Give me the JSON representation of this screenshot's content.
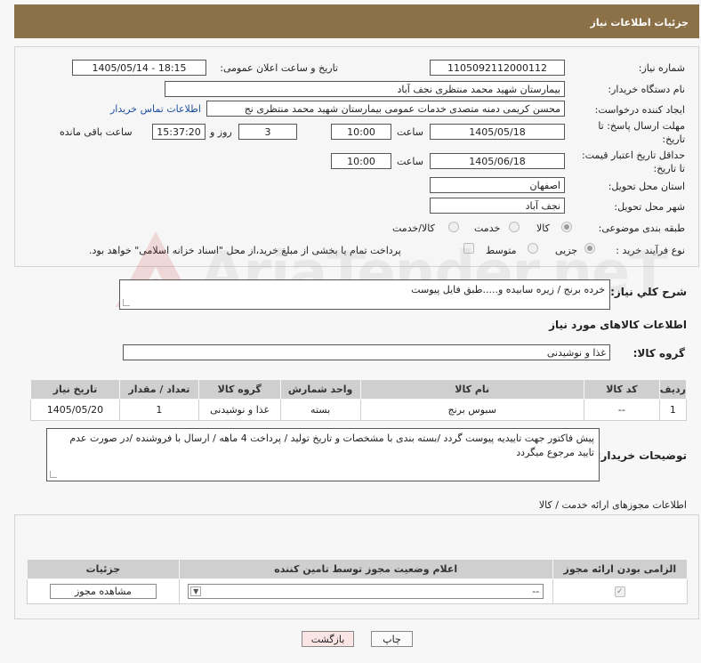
{
  "page_title": "جزئیات اطلاعات نیاز",
  "fields": {
    "need_number_label": "شماره نیاز:",
    "need_number": "1105092112000112",
    "announce_label": "تاریخ و ساعت اعلان عمومی:",
    "announce_value": "1405/05/14 - 18:15",
    "buyer_org_label": "نام دستگاه خریدار:",
    "buyer_org": "بیمارستان شهید محمد منتظری نجف آباد",
    "creator_label": "ایجاد کننده درخواست:",
    "creator": "محسن کریمی دمنه متصدی خدمات عمومی بیمارستان شهید محمد منتظری نج",
    "contact_link": "اطلاعات تماس خریدار",
    "deadline_label_1": "مهلت ارسال پاسخ: تا",
    "deadline_label_2": "تاریخ:",
    "deadline_date": "1405/05/18",
    "time_label": "ساعت",
    "deadline_time": "10:00",
    "days": "3",
    "days_and_label": "روز و",
    "remaining_time": "15:37:20",
    "remaining_label": "ساعت باقی مانده",
    "price_label_1": "حداقل تاریخ اعتبار قیمت:",
    "price_label_2": "تا تاریخ:",
    "price_date": "1405/06/18",
    "price_time": "10:00",
    "province_label": "استان محل تحویل:",
    "province": "اصفهان",
    "city_label": "شهر محل تحویل:",
    "city": "نجف آباد",
    "category_label": "طبقه بندی موضوعی:",
    "category_options": [
      "کالا",
      "خدمت",
      "کالا/خدمت"
    ],
    "process_label": "نوع فرآیند خرید :",
    "process_options": [
      "جزیی",
      "متوسط"
    ],
    "payment_note": "پرداخت تمام یا بخشی از مبلغ خرید،از محل \"اسناد خزانه اسلامی\" خواهد بود."
  },
  "description": {
    "label": "شرح كلي نياز:",
    "value": "خرده برنج / زیره سابیده و.....طبق فایل پیوست"
  },
  "goods": {
    "section_title": "اطلاعات کالاهای مورد نیاز",
    "group_label": "گروه کالا:",
    "group_value": "غذا و نوشیدنی",
    "columns": [
      "ردیف",
      "کد کالا",
      "نام کالا",
      "واحد شمارش",
      "گروه کالا",
      "تعداد / مقدار",
      "تاریخ نیاز"
    ],
    "rows": [
      [
        "1",
        "--",
        "سبوس برنج",
        "بسته",
        "غذا و نوشیدنی",
        "1",
        "1405/05/20"
      ]
    ]
  },
  "buyer_notes": {
    "label": "توضیحات خریدار:",
    "value": "پیش فاکتور جهت تاییدیه پیوست گردد /بسته بندی با مشخصات و تاریخ تولید / پرداخت 4 ماهه / ارسال با فروشنده /در صورت عدم تایید مرجوع میگردد"
  },
  "permits": {
    "section_title": "اطلاعات مجوزهای ارائه خدمت / کالا",
    "columns": [
      "الزامی بودن ارائه مجوز",
      "اعلام وضعیت مجوز توسط تامین کننده",
      "جزئیات"
    ],
    "select_value": "--",
    "view_button": "مشاهده مجوز"
  },
  "buttons": {
    "print": "چاپ",
    "back": "بازگشت"
  },
  "watermark": "AriaTender.neT"
}
